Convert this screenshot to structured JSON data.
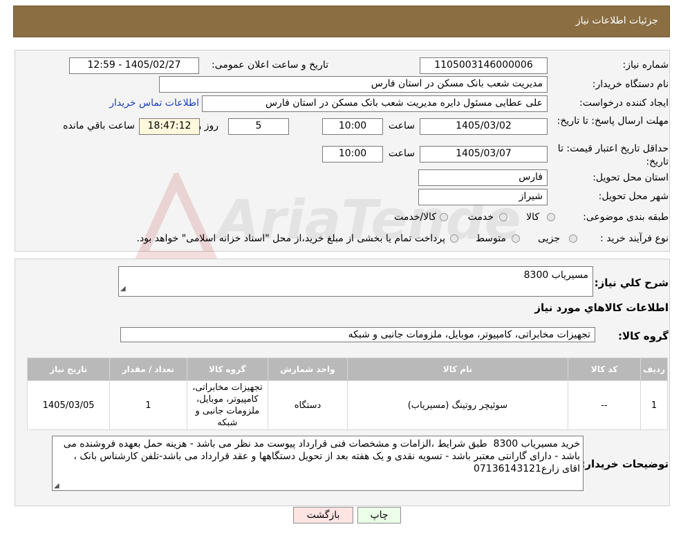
{
  "header": {
    "title": "جزئیات اطلاعات نیاز"
  },
  "form": {
    "need_number": {
      "label": "شماره نیاز:",
      "value": "1105003146000006"
    },
    "announce": {
      "label": "تاریخ و ساعت اعلان عمومی:",
      "value": "1405/02/27 - 12:59"
    },
    "buyer_org": {
      "label": "نام دستگاه خریدار:",
      "value": "مدیریت شعب بانک مسکن در استان فارس"
    },
    "requester": {
      "label": "ایجاد کننده درخواست:",
      "value": "علی عطایی مسئول دایره مدیریت شعب بانک مسکن در استان فارس",
      "contact_link": "اطلاعات تماس خریدار"
    },
    "deadline": {
      "label": "مهلت ارسال پاسخ: تا تاریخ:",
      "date": "1405/03/02",
      "time_label": "ساعت",
      "time": "10:00",
      "days": "5",
      "days_label": "روز و",
      "remaining_time": "18:47:12",
      "remaining_label": "ساعت باقي مانده"
    },
    "validity": {
      "label": "حداقل تاریخ اعتبار قیمت: تا تاریخ:",
      "date": "1405/03/07",
      "time_label": "ساعت",
      "time": "10:00"
    },
    "province": {
      "label": "استان محل تحویل:",
      "value": "فارس"
    },
    "city": {
      "label": "شهر محل تحویل:",
      "value": "شیراز"
    },
    "category": {
      "label": "طبقه بندی موضوعی:",
      "options": [
        "کالا",
        "خدمت",
        "کالا/خدمت"
      ]
    },
    "process": {
      "label": "نوع فرآیند خرید :",
      "options": [
        "جزیی",
        "متوسط"
      ],
      "note": "پرداخت تمام یا بخشی از مبلغ خرید،از محل \"اسناد خزانه اسلامی\" خواهد بود."
    }
  },
  "summary": {
    "label": "شرح کلي نياز:",
    "value": "مسیریاب 8300",
    "goods_info_title": "اطلاعات کالاهاي مورد نياز",
    "group_label": "گروه کالا:",
    "group_value": "تجهیزات مخابراتی، کامپیوتر، موبایل، ملزومات جانبی و شبکه"
  },
  "table": {
    "headers": [
      "ردیف",
      "کد کالا",
      "نام کالا",
      "واحد شمارش",
      "گروه کالا",
      "تعداد / مقدار",
      "تاریخ نیاز"
    ],
    "rows": [
      {
        "row": "1",
        "code": "--",
        "name": "سوئیچر روتینگ (مسیریاب)",
        "unit": "دستگاه",
        "group": "تجهیزات مخابراتی، کامپیوتر، موبایل، ملزومات جانبی و شبکه",
        "qty": "1",
        "date": "1405/03/05"
      }
    ]
  },
  "notes": {
    "label": "توضیحات خریدار:",
    "value": "خرید مسیریاب 8300  طبق شرایط ،الزامات و مشخصات فنی قرارداد پیوست مد نظر می باشد - هزینه حمل بعهده فروشنده می باشد - دارای گارانتی معتبر باشد - تسویه نقدی و یک هفته بعد از تحویل دستگاهها و عقد قرارداد می باشد-تلفن کارشناس بانک ، اقای زارع07136143121"
  },
  "buttons": {
    "print": "چاپ",
    "back": "بازگشت"
  },
  "watermark": {
    "text": "AriaTender.neT"
  },
  "colors": {
    "header_bg": "#8b6f43",
    "link": "#1a3fb8",
    "back_button_bg": "#ffe4e4",
    "print_button_bg": "#ecffe9"
  }
}
